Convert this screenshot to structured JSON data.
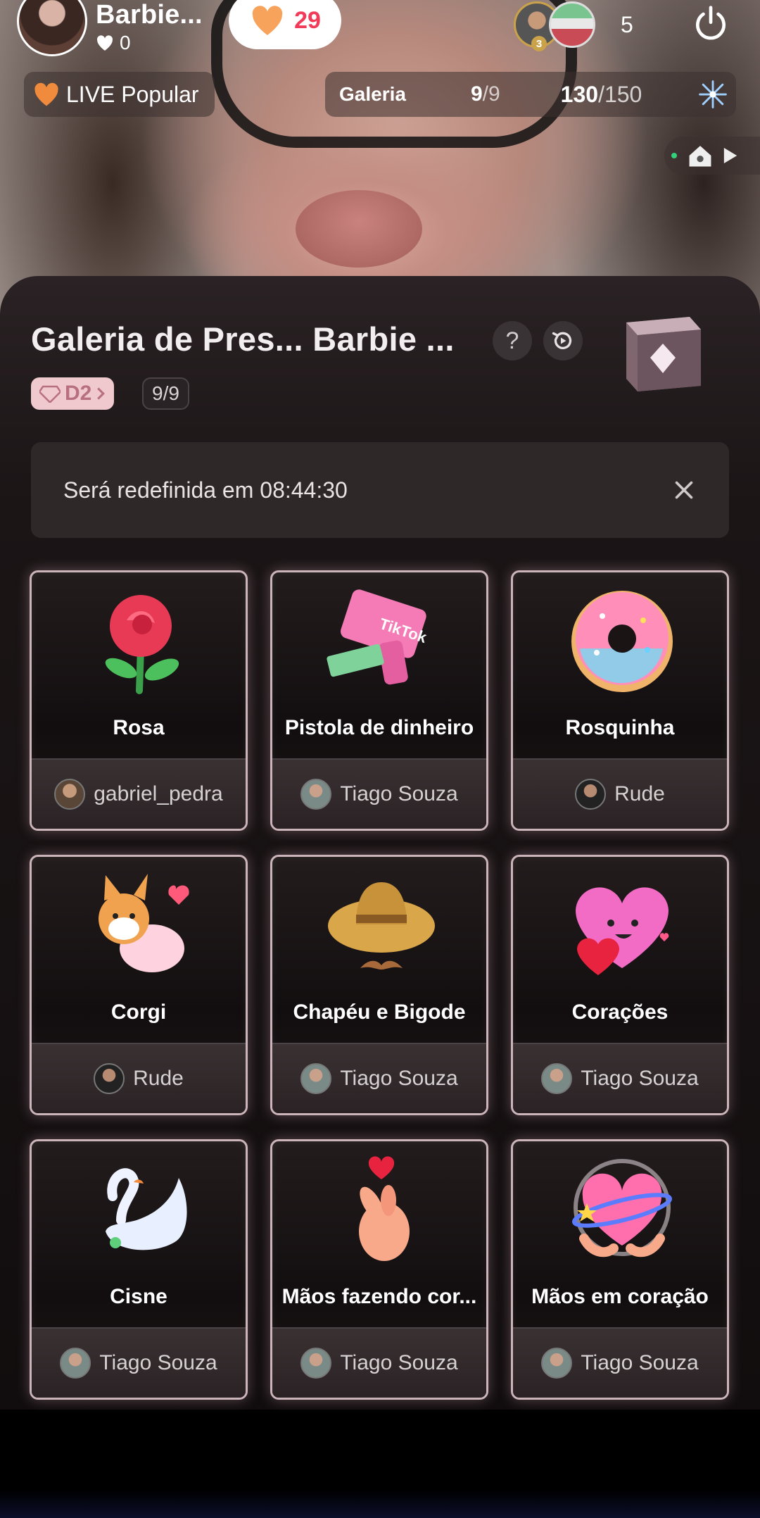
{
  "header": {
    "host_name": "Barbie...",
    "host_likes": "0",
    "like_count": "29",
    "viewer_rank": "3",
    "viewer_count": "5"
  },
  "badges": {
    "live_popular": "LIVE Popular"
  },
  "gallery_bar": {
    "title": "Galeria",
    "count_done": "9",
    "count_total": "/9",
    "progress_done": "130",
    "progress_total": "/150"
  },
  "panel": {
    "title": "Galeria de Pres... Barbie ...",
    "help_label": "?",
    "level_badge": "D2",
    "progress": "9/9",
    "reset_text": "Será redefinida em 08:44:30"
  },
  "gifts": [
    {
      "name": "Rosa",
      "sender": "gabriel_pedra",
      "icon": "rose-icon"
    },
    {
      "name": "Pistola de dinheiro",
      "sender": "Tiago Souza",
      "icon": "money-gun-icon"
    },
    {
      "name": "Rosquinha",
      "sender": "Rude",
      "icon": "donut-icon"
    },
    {
      "name": "Corgi",
      "sender": "Rude",
      "icon": "corgi-icon"
    },
    {
      "name": "Chapéu e Bigode",
      "sender": "Tiago Souza",
      "icon": "hat-mustache-icon"
    },
    {
      "name": "Corações",
      "sender": "Tiago Souza",
      "icon": "hearts-icon"
    },
    {
      "name": "Cisne",
      "sender": "Tiago Souza",
      "icon": "swan-icon"
    },
    {
      "name": "Mãos fazendo cor...",
      "sender": "Tiago Souza",
      "icon": "finger-heart-icon"
    },
    {
      "name": "Mãos em coração",
      "sender": "Tiago Souza",
      "icon": "hand-heart-icon"
    }
  ],
  "colors": {
    "accent_red": "#f23b59",
    "badge_pink": "#f0c9cf",
    "panel_bg": "#1b1516"
  }
}
